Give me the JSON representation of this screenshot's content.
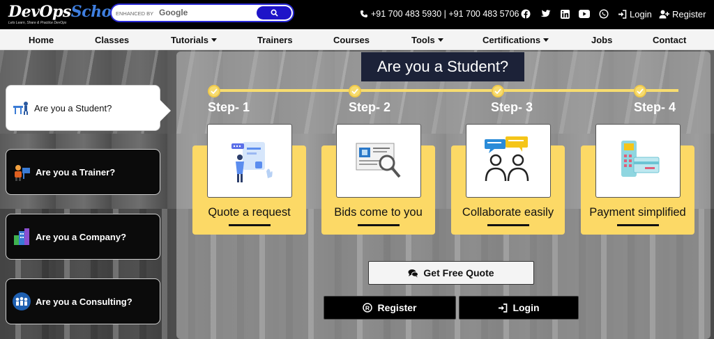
{
  "logo": {
    "devops": "DevOps",
    "school": "School",
    "tagline": "Lets Learn, Share & Practice DevOps"
  },
  "search": {
    "placeholder": "ENHANCED BY",
    "brand": "Google"
  },
  "topbar": {
    "phones": "+91 700 483 5930 | +91 700 483 5706",
    "login_label": "Login",
    "register_label": "Register"
  },
  "nav": {
    "items": [
      {
        "label": "Home"
      },
      {
        "label": "Classes"
      },
      {
        "label": "Tutorials"
      },
      {
        "label": "Trainers"
      },
      {
        "label": "Courses"
      },
      {
        "label": "Tools"
      },
      {
        "label": "Certifications"
      },
      {
        "label": "Jobs"
      },
      {
        "label": "Contact"
      }
    ]
  },
  "sidebar": {
    "items": [
      {
        "label": "Are you a Student?",
        "active": true
      },
      {
        "label": "Are you a Trainer?",
        "active": false
      },
      {
        "label": "Are you a Company?",
        "active": false
      },
      {
        "label": "Are you a Consulting?",
        "active": false
      }
    ]
  },
  "main": {
    "title": "Are you a Student?",
    "steps": [
      {
        "label": "Step- 1",
        "title": "Quote a request"
      },
      {
        "label": "Step- 2",
        "title": "Bids come to you"
      },
      {
        "label": "Step- 3",
        "title": "Collaborate easily"
      },
      {
        "label": "Step- 4",
        "title": "Payment simplified"
      }
    ],
    "quote_button": "Get Free Quote",
    "register_button": "Register",
    "login_button": "Login"
  },
  "colors": {
    "accent": "#fcd966",
    "search_button": "#1e14c8",
    "title_bg": "#1c2238"
  }
}
